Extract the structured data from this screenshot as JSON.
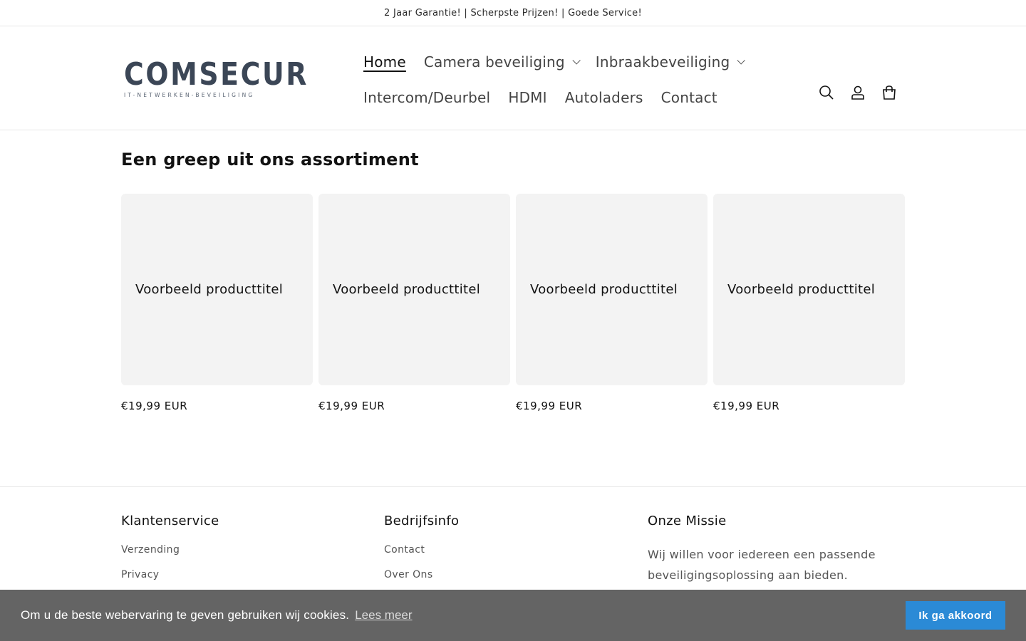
{
  "announcement": "2 Jaar Garantie! | Scherpste Prijzen! | Goede Service!",
  "brand": {
    "name": "COMSECUR",
    "tagline": "IT-NETWERKEN-BEVEILIGING",
    "accent_blue": "#2b8ad6",
    "logo_gray": "#3b4656"
  },
  "nav": {
    "row1": [
      {
        "label": "Home",
        "active": true
      },
      {
        "label": "Camera beveiliging",
        "dropdown": true
      },
      {
        "label": "Inbraakbeveiliging",
        "dropdown": true
      }
    ],
    "row2": [
      {
        "label": "Intercom/Deurbel"
      },
      {
        "label": "HDMI"
      },
      {
        "label": "Autoladers"
      },
      {
        "label": "Contact"
      }
    ]
  },
  "header_icons": [
    "search-icon",
    "account-icon",
    "cart-icon"
  ],
  "section": {
    "title": "Een greep uit ons assortiment"
  },
  "products": [
    {
      "title": "Voorbeeld producttitel",
      "price": "€19,99 EUR"
    },
    {
      "title": "Voorbeeld producttitel",
      "price": "€19,99 EUR"
    },
    {
      "title": "Voorbeeld producttitel",
      "price": "€19,99 EUR"
    },
    {
      "title": "Voorbeeld producttitel",
      "price": "€19,99 EUR"
    }
  ],
  "footer": {
    "col1": {
      "title": "Klantenservice",
      "links": [
        "Verzending",
        "Privacy"
      ]
    },
    "col2": {
      "title": "Bedrijfsinfo",
      "links": [
        "Contact",
        "Over Ons"
      ]
    },
    "col3": {
      "title": "Onze Missie",
      "text": "Wij willen voor iedereen een passende beveiligingsoplossing aan bieden."
    }
  },
  "cookie": {
    "message": "Om u de beste webervaring te geven gebruiken wij cookies.",
    "link": "Lees meer",
    "button": "Ik ga akkoord",
    "bg": "#646464",
    "button_color": "#2b8ad6"
  }
}
